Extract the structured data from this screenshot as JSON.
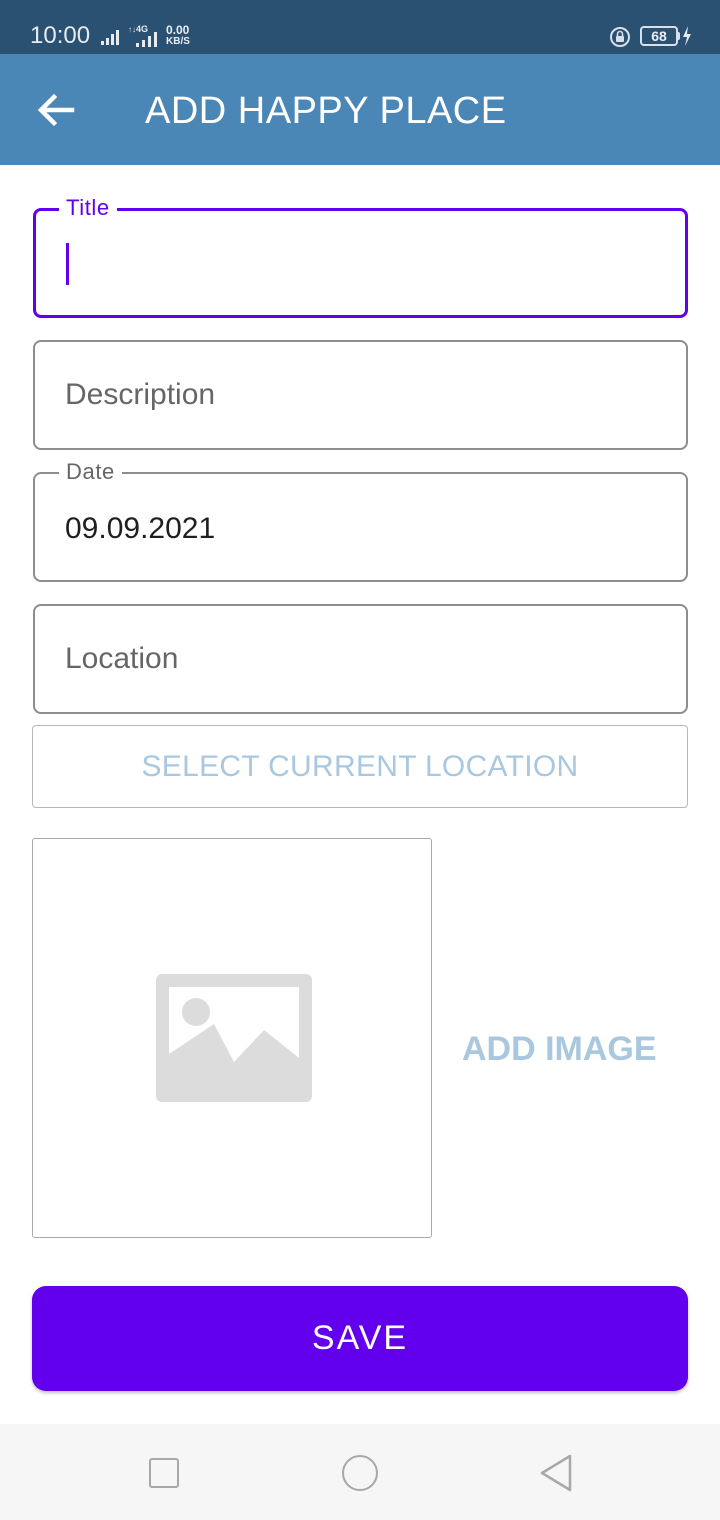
{
  "status_bar": {
    "time": "10:00",
    "net_small": "↑↓",
    "network_type": "4G",
    "speed_value": "0.00",
    "speed_unit": "KB/S",
    "battery": "68"
  },
  "app_bar": {
    "title": "ADD HAPPY PLACE",
    "color": "#4b87b6"
  },
  "form": {
    "title_field": {
      "label": "Title",
      "value": ""
    },
    "description_field": {
      "placeholder": "Description"
    },
    "date_field": {
      "label": "Date",
      "value": "09.09.2021"
    },
    "location_field": {
      "placeholder": "Location"
    },
    "select_location_label": "SELECT CURRENT LOCATION",
    "add_image_label": "ADD IMAGE",
    "save_label": "SAVE"
  },
  "colors": {
    "accent": "#6200ee",
    "status_bar": "#2b5172",
    "link_text": "#a9c7df"
  },
  "icons": {
    "back": "arrow-left-icon",
    "image_placeholder": "image-placeholder-icon",
    "nav_recent": "square-icon",
    "nav_home": "circle-icon",
    "nav_back": "triangle-back-icon"
  }
}
